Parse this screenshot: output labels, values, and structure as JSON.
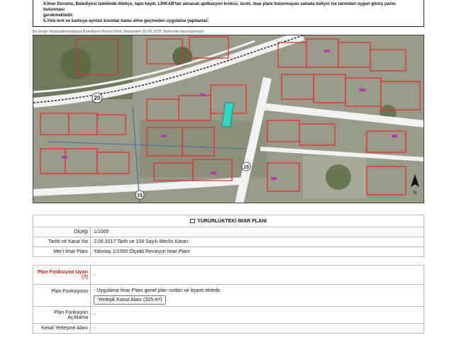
{
  "notes": {
    "line1": "4.İmar Durumu, Belediyesi talebinde dilekçe, tapu kaydı, LİHKAB'tan alınacak aplikasyon krokisi, ücret, imar planı bulunmayan sahada kaliyor ise tarımdan uygun görüş yazısı bulunması",
    "line2": "gerekmektedir.",
    "line3": "5.Yola terk ve kamuya ayrılan kısımlar kamu eline geçmeden uygulama yapılamaz."
  },
  "map": {
    "source_text": "Bu belge Mustafakemalpaşa Belediyesi Resmi Web Sitesinden 26.06.2025 Tarihinde Hazırlanmıştır.",
    "road_labels": [
      "20",
      "15",
      "15"
    ],
    "north_label": "N"
  },
  "plan": {
    "title": "YÜRÜRLÜKTEKİ İMAR PLANI",
    "rows": [
      {
        "label": "Ölçeği",
        "value": "1/1000"
      },
      {
        "label": "Tarihi ve Karar No",
        "value": "2.06.2017 Tarih ve 104 Sayılı Meclis Kararı"
      },
      {
        "label": "Mer'i İmar Planı",
        "value": "Yalıntaş 1/1000 Ölçekli Revizyon İmar Planı"
      }
    ]
  },
  "fonksiyon": {
    "uyari_label": "Plan Fonksiyon Uyarı (?)",
    "uyari_value": "-",
    "fonk_label": "Plan Fonksiyonu",
    "fonk_value": "- Uygulama İmar Planı genel plan notları ve lejantı ektedir.",
    "fonk_pill": "Yerleşik Konut Alanı (325 m²)",
    "aciklama_label": "Plan Fonksiyon Açıklama",
    "aciklama_value": "-",
    "kesal_label": "Kesal Yerleşme Alanı",
    "kesal_value": "-"
  },
  "colors": {
    "parcel_red": "#e03030",
    "road_white": "#f2f2f2",
    "highlight": "#33d6c0"
  }
}
